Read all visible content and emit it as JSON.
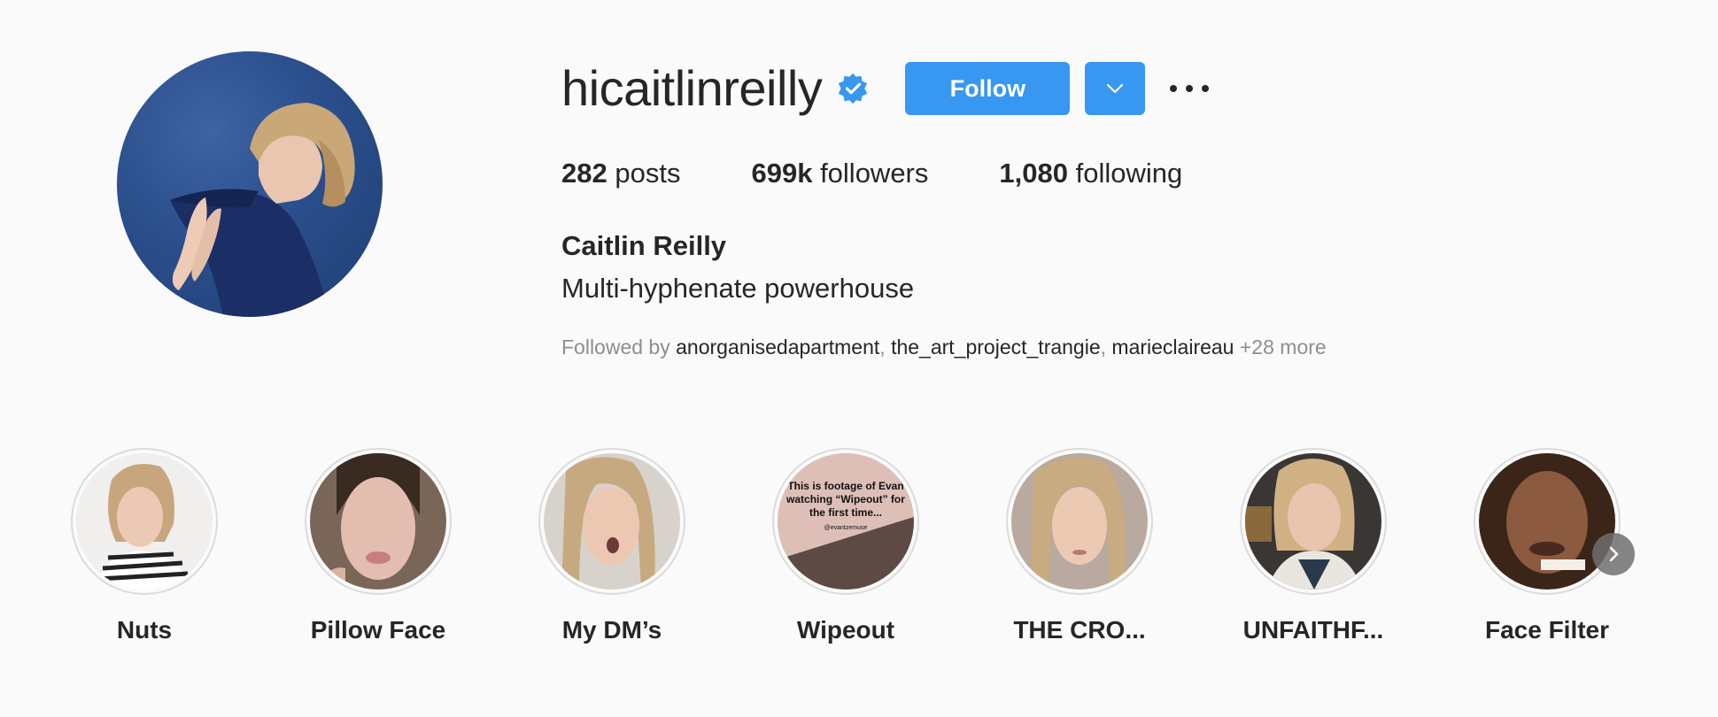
{
  "profile": {
    "username": "hicaitlinreilly",
    "verified": true,
    "follow_label": "Follow",
    "full_name": "Caitlin Reilly",
    "bio": "Multi-hyphenate powerhouse",
    "stats": {
      "posts_count": "282",
      "posts_label": "posts",
      "followers_count": "699k",
      "followers_label": "followers",
      "following_count": "1,080",
      "following_label": "following"
    },
    "followed_by": {
      "prefix": "Followed by",
      "users": [
        "anorganisedapartment",
        "the_art_project_trangie",
        "marieclaireau"
      ],
      "separator": ",",
      "more": "+28 more"
    }
  },
  "highlights": [
    {
      "label": "Nuts"
    },
    {
      "label": "Pillow Face"
    },
    {
      "label": "My DM’s"
    },
    {
      "label": "Wipeout",
      "thumb_text": "This is footage of Evan watching “Wipeout” for the first time...",
      "thumb_handle": "@evantzemuse"
    },
    {
      "label": "THE CRO..."
    },
    {
      "label": "UNFAITHF..."
    },
    {
      "label": "Face Filter"
    }
  ],
  "colors": {
    "accent": "#3897f0",
    "background": "#fafafa",
    "text": "#262626",
    "muted": "#8e8e8e"
  },
  "icons": {
    "verified": "verified-badge-icon",
    "dropdown": "chevron-down-icon",
    "more": "more-options-icon",
    "next": "chevron-right-icon"
  }
}
